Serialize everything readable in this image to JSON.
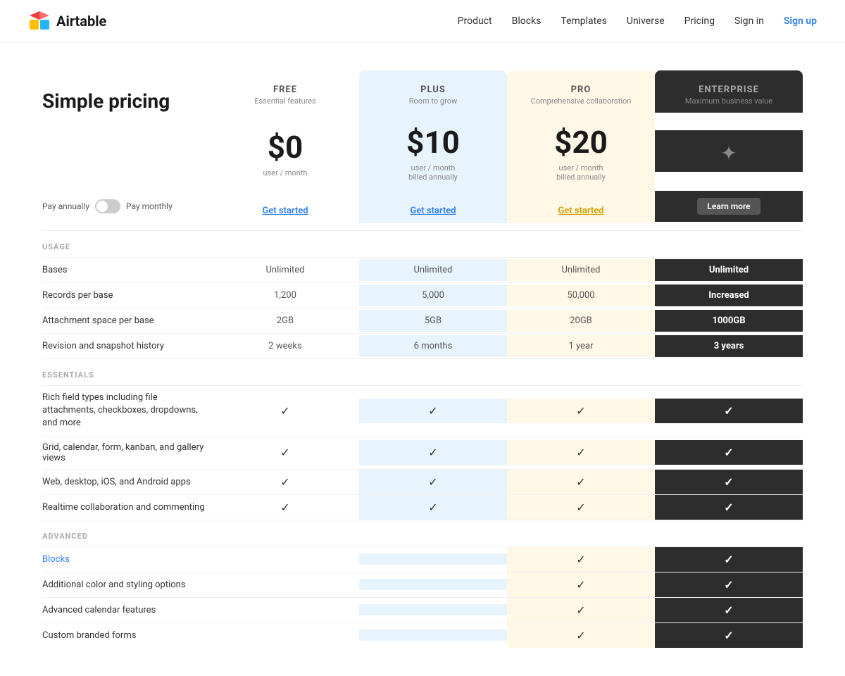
{
  "nav": {
    "logo_text": "Airtable",
    "links": [
      "Product",
      "Blocks",
      "Templates",
      "Universe",
      "Pricing",
      "Sign in"
    ],
    "signup": "Sign up"
  },
  "pricing": {
    "title": "Simple pricing",
    "billing_toggle": {
      "pay_annually": "Pay annually",
      "pay_monthly": "Pay monthly"
    },
    "plans": [
      {
        "id": "free",
        "name": "FREE",
        "subtitle": "Essential features",
        "price": "$0",
        "price_sub": "user / month",
        "cta": "Get started",
        "cta_style": "blue"
      },
      {
        "id": "plus",
        "name": "PLUS",
        "subtitle": "Room to grow",
        "price": "$10",
        "price_sub": "user / month\nbilled annually",
        "cta": "Get started",
        "cta_style": "blue"
      },
      {
        "id": "pro",
        "name": "PRO",
        "subtitle": "Comprehensive collaboration",
        "price": "$20",
        "price_sub": "user / month\nbilled annually",
        "cta": "Get started",
        "cta_style": "gold"
      },
      {
        "id": "enterprise",
        "name": "ENTERPRISE",
        "subtitle": "Maximum business value",
        "price": "",
        "price_sub": "",
        "cta": "Learn more",
        "cta_style": "enterprise"
      }
    ],
    "sections": [
      {
        "label": "USAGE",
        "rows": [
          {
            "feature": "Bases",
            "free": "Unlimited",
            "plus": "Unlimited",
            "pro": "Unlimited",
            "enterprise": "Unlimited",
            "enterprise_bold": true
          },
          {
            "feature": "Records per base",
            "free": "1,200",
            "plus": "5,000",
            "pro": "50,000",
            "enterprise": "Increased",
            "enterprise_bold": true
          },
          {
            "feature": "Attachment space per base",
            "free": "2GB",
            "plus": "5GB",
            "pro": "20GB",
            "enterprise": "1000GB",
            "enterprise_bold": true
          },
          {
            "feature": "Revision and snapshot history",
            "free": "2 weeks",
            "plus": "6 months",
            "pro": "1 year",
            "enterprise": "3 years",
            "enterprise_bold": true
          }
        ]
      },
      {
        "label": "ESSENTIALS",
        "rows": [
          {
            "feature": "Rich field types including file attachments, checkboxes, dropdowns, and more",
            "free": "check",
            "plus": "check",
            "pro": "check",
            "enterprise": "check"
          },
          {
            "feature": "Grid, calendar, form, kanban, and gallery views",
            "free": "check",
            "plus": "check",
            "pro": "check",
            "enterprise": "check"
          },
          {
            "feature": "Web, desktop, iOS, and Android apps",
            "free": "check",
            "plus": "check",
            "pro": "check",
            "enterprise": "check"
          },
          {
            "feature": "Realtime collaboration and commenting",
            "free": "check",
            "plus": "check",
            "pro": "check",
            "enterprise": "check"
          }
        ]
      },
      {
        "label": "ADVANCED",
        "rows": [
          {
            "feature": "Blocks",
            "free": "",
            "plus": "",
            "pro": "check",
            "enterprise": "check",
            "feature_link": true
          },
          {
            "feature": "Additional color and styling options",
            "free": "",
            "plus": "",
            "pro": "check",
            "enterprise": "check"
          },
          {
            "feature": "Advanced calendar features",
            "free": "",
            "plus": "",
            "pro": "check",
            "enterprise": "check"
          },
          {
            "feature": "Custom branded forms",
            "free": "",
            "plus": "",
            "pro": "check",
            "enterprise": "check"
          }
        ]
      }
    ]
  }
}
